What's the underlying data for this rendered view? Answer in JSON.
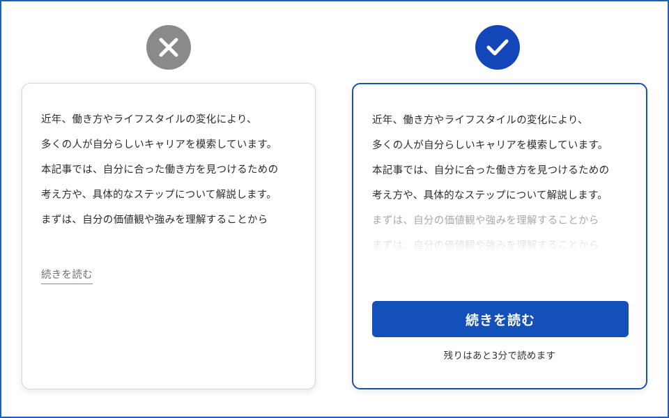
{
  "icons": {
    "bad": "close-icon",
    "good": "check-icon"
  },
  "colors": {
    "frame_border": "#1a5fc4",
    "bad_badge": "#8a8a8a",
    "good_badge": "#1346b8",
    "cta_background": "#1450ba"
  },
  "bad_card": {
    "lines": [
      "近年、働き方やライフスタイルの変化により、",
      "多くの人が自分らしいキャリアを模索しています。",
      "本記事では、自分に合った働き方を見つけるための",
      "考え方や、具体的なステップについて解説します。",
      "まずは、自分の価値観や強みを理解することから"
    ],
    "read_more": "続きを読む"
  },
  "good_card": {
    "lines": [
      "近年、働き方やライフスタイルの変化により、",
      "多くの人が自分らしいキャリアを模索しています。",
      "本記事では、自分に合った働き方を見つけるための",
      "考え方や、具体的なステップについて解説します。",
      "まずは、自分の価値観や強みを理解することから",
      "まずは、自分の価値観や強みを理解することから"
    ],
    "button": "続きを読む",
    "note": "残りはあと3分で読めます"
  }
}
